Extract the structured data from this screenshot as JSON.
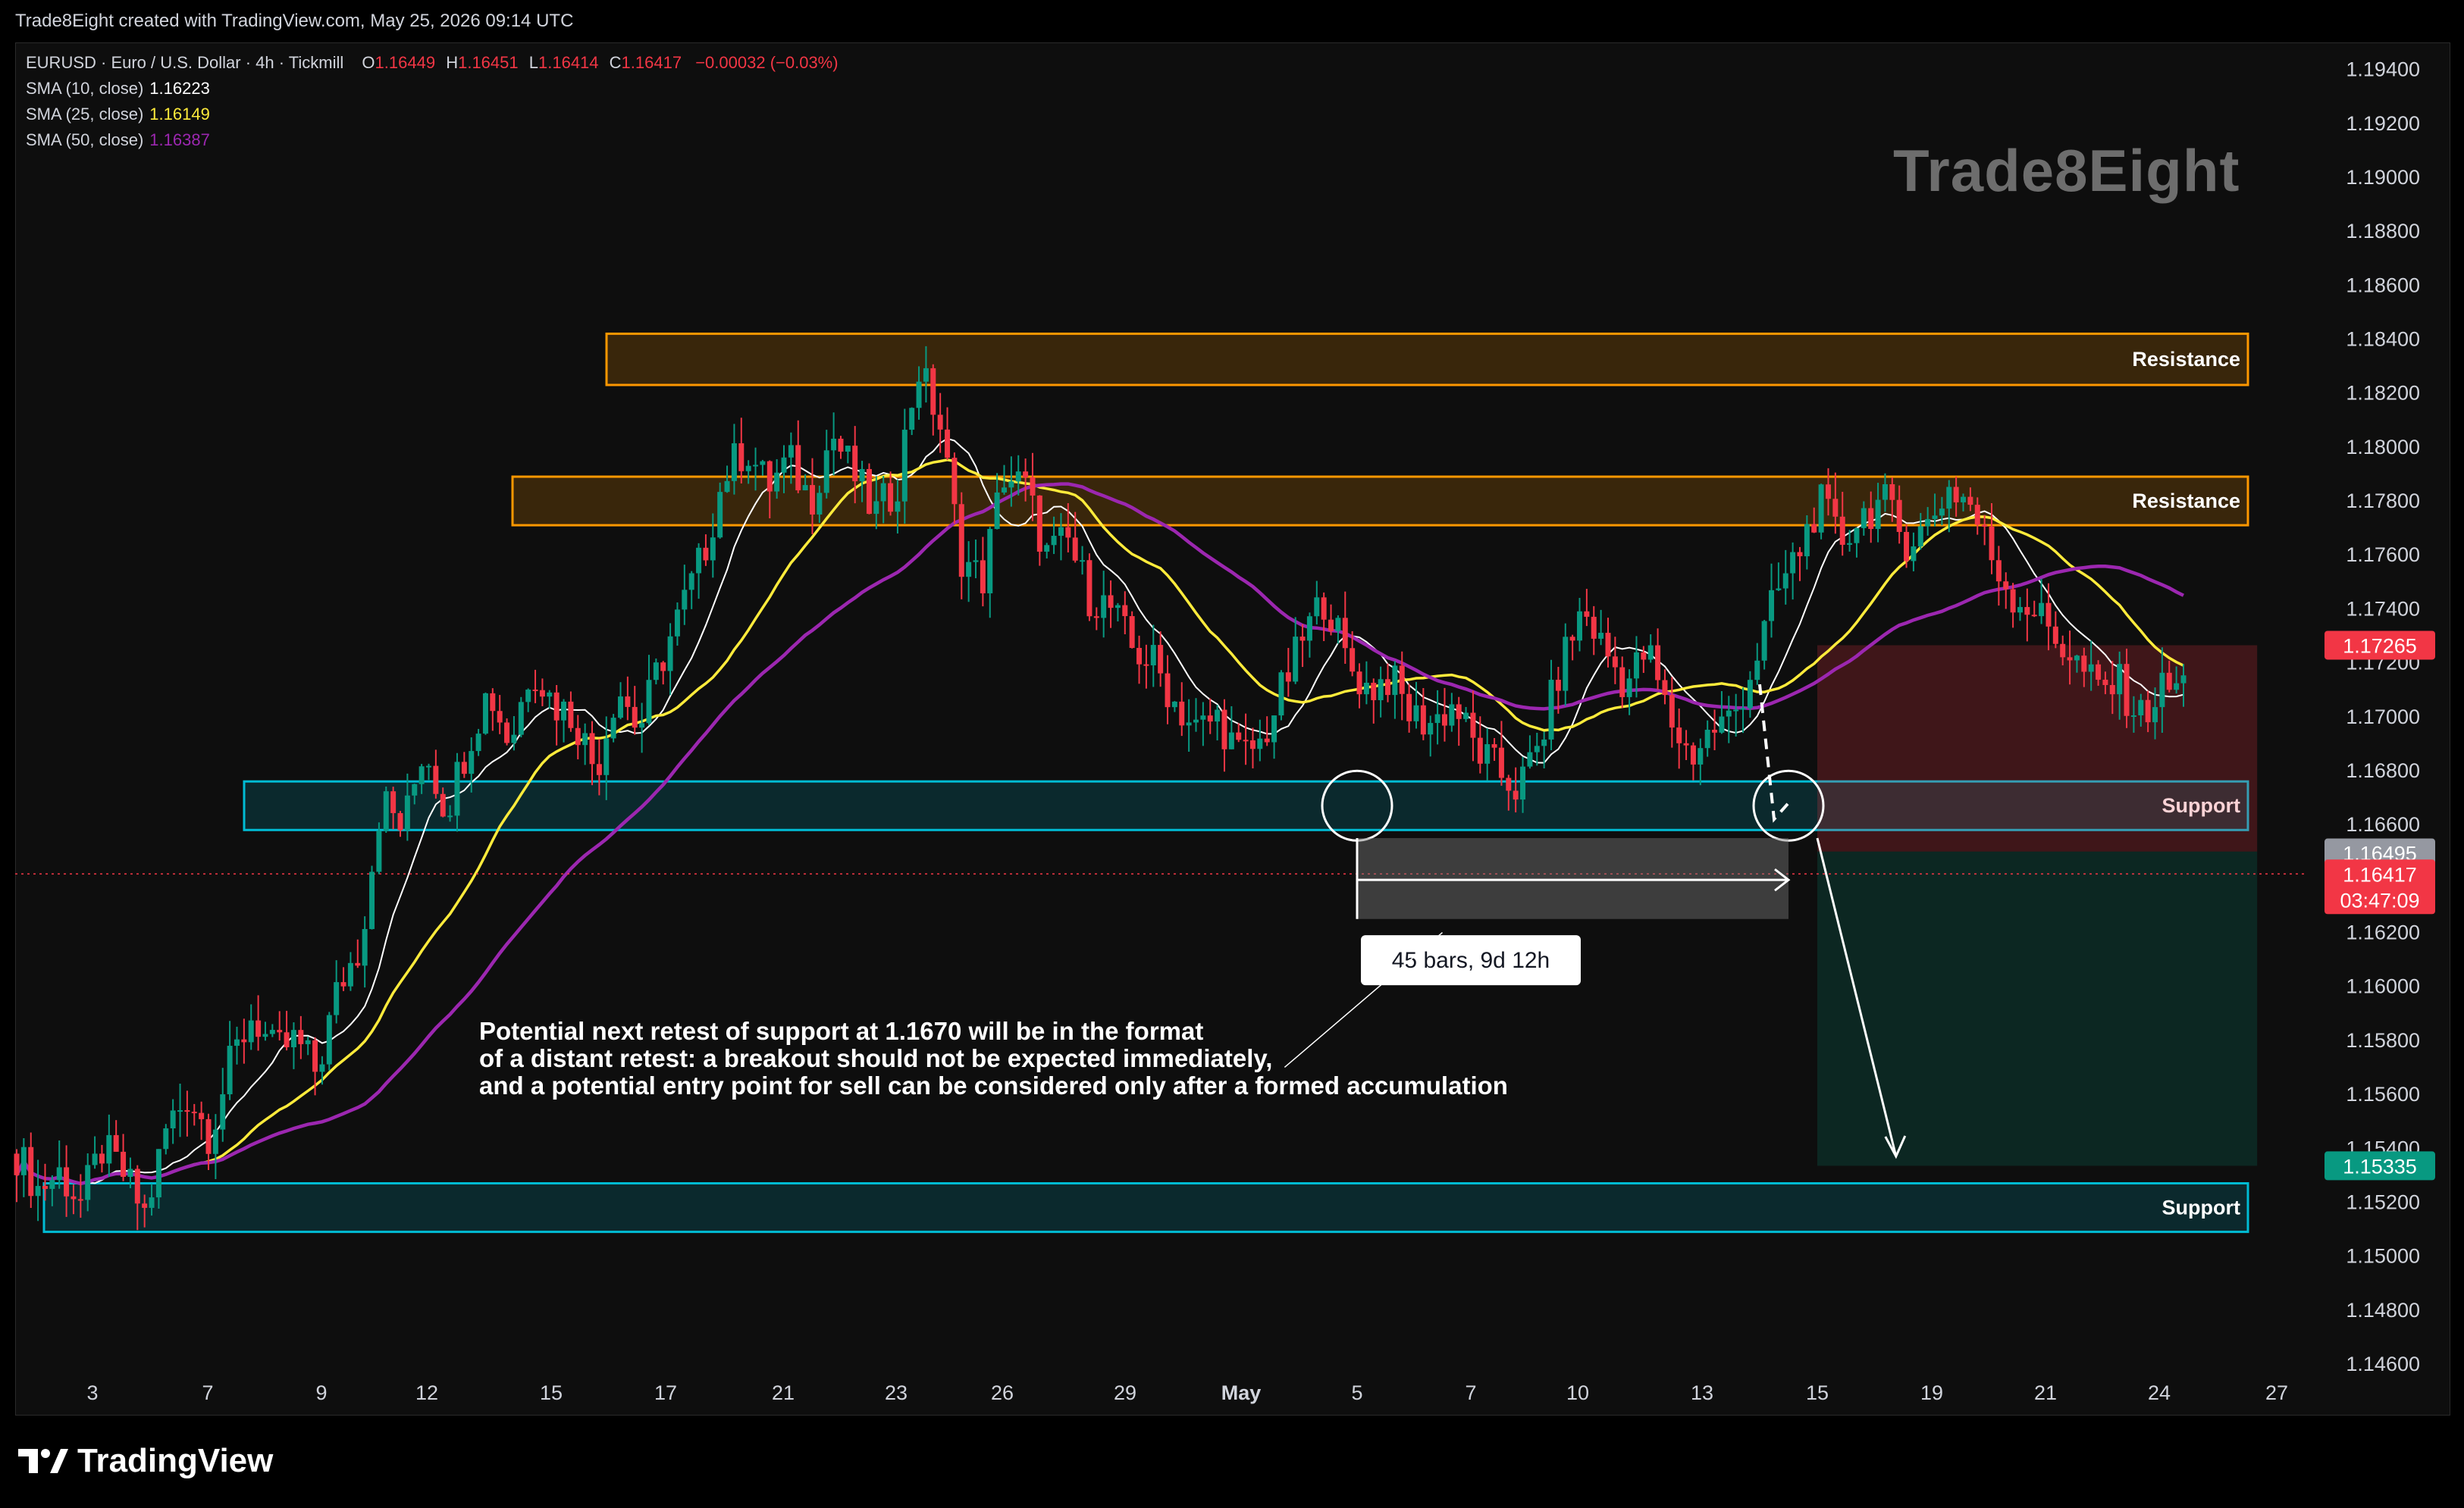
{
  "caption": "Trade8Eight created with TradingView.com, May 25, 2026 09:14 UTC",
  "legend": {
    "symbol": "EURUSD · Euro / U.S. Dollar · 4h · Tickmill",
    "o_label": "O",
    "o": "1.16449",
    "h_label": "H",
    "h": "1.16451",
    "l_label": "L",
    "l": "1.16414",
    "c_label": "C",
    "c": "1.16417",
    "change": "−0.00032 (−0.03%)",
    "sma10_label": "SMA (10, close)",
    "sma10": "1.16223",
    "sma25_label": "SMA (25, close)",
    "sma25": "1.16149",
    "sma50_label": "SMA (50, close)",
    "sma50": "1.16387"
  },
  "watermark": "Trade8Eight",
  "brand": "TradingView",
  "colors": {
    "bull": "#089981",
    "bear": "#f23645",
    "sma10": "#ffffff",
    "sma25": "#ffeb3b",
    "sma50": "#9c27b0",
    "resistance": "#ff9800",
    "support": "#00bcd4"
  },
  "chart_data": {
    "type": "candlestick",
    "symbol": "EURUSD",
    "timeframe": "4h",
    "ylim": [
      1.146,
      1.195
    ],
    "y_ticks": [
      "1.19400",
      "1.19200",
      "1.19000",
      "1.18800",
      "1.18600",
      "1.18400",
      "1.18200",
      "1.18000",
      "1.17800",
      "1.17600",
      "1.17400",
      "1.17200",
      "1.17000",
      "1.16800",
      "1.16600",
      "1.16200",
      "1.16000",
      "1.15800",
      "1.15600",
      "1.15400",
      "1.15200",
      "1.15000",
      "1.14800",
      "1.14600"
    ],
    "x_ticks": [
      {
        "label": "3",
        "date": "2026-04-03"
      },
      {
        "label": "7",
        "date": "2026-04-07"
      },
      {
        "label": "9",
        "date": "2026-04-09"
      },
      {
        "label": "12",
        "date": "2026-04-12"
      },
      {
        "label": "15",
        "date": "2026-04-15"
      },
      {
        "label": "17",
        "date": "2026-04-17"
      },
      {
        "label": "21",
        "date": "2026-04-21"
      },
      {
        "label": "23",
        "date": "2026-04-23"
      },
      {
        "label": "26",
        "date": "2026-04-26"
      },
      {
        "label": "29",
        "date": "2026-04-29"
      },
      {
        "label": "May",
        "date": "2026-05-01"
      },
      {
        "label": "5",
        "date": "2026-05-05"
      },
      {
        "label": "7",
        "date": "2026-05-07"
      },
      {
        "label": "10",
        "date": "2026-05-10"
      },
      {
        "label": "13",
        "date": "2026-05-13"
      },
      {
        "label": "15",
        "date": "2026-05-15"
      },
      {
        "label": "19",
        "date": "2026-05-19"
      },
      {
        "label": "21",
        "date": "2026-05-21"
      },
      {
        "label": "24",
        "date": "2026-05-24"
      },
      {
        "label": "27",
        "date": "2026-05-27"
      }
    ],
    "closes": [
      1.1538,
      1.1525,
      1.1531,
      1.152,
      1.154,
      1.153,
      1.1515,
      1.1548,
      1.156,
      1.1545,
      1.1572,
      1.159,
      1.1575,
      1.158,
      1.1568,
      1.16,
      1.1615,
      1.167,
      1.1658,
      1.169,
      1.1665,
      1.169,
      1.171,
      1.169,
      1.172,
      1.1705,
      1.17,
      1.168,
      1.1712,
      1.1695,
      1.172,
      1.174,
      1.176,
      1.179,
      1.18,
      1.1785,
      1.1795,
      1.178,
      1.1805,
      1.179,
      1.1775,
      1.1785,
      1.183,
      1.181,
      1.176,
      1.175,
      1.179,
      1.1785,
      1.176,
      1.1765,
      1.1745,
      1.174,
      1.1725,
      1.172,
      1.1705,
      1.1695,
      1.17,
      1.1685,
      1.169,
      1.171,
      1.173,
      1.1745,
      1.172,
      1.171,
      1.1715,
      1.17,
      1.1698,
      1.1705,
      1.1688,
      1.168,
      1.1673,
      1.169,
      1.172,
      1.174,
      1.1725,
      1.1712,
      1.1725,
      1.17,
      1.1685,
      1.1695,
      1.17,
      1.172,
      1.1745,
      1.176,
      1.178,
      1.1765,
      1.1775,
      1.178,
      1.1765,
      1.177,
      1.1785,
      1.178,
      1.176,
      1.1745,
      1.174,
      1.173,
      1.172,
      1.171,
      1.1712,
      1.17,
      1.171,
      1.1712
    ],
    "sma10": [
      1.155,
      1.1535,
      1.153,
      1.1528,
      1.153,
      1.1533,
      1.1535,
      1.154,
      1.1548,
      1.1556
    ],
    "sma25": [
      1.1555,
      1.155,
      1.1545,
      1.1543,
      1.1545,
      1.1548,
      1.1555,
      1.1565,
      1.158,
      1.16
    ],
    "sma50": [
      1.156,
      1.156,
      1.1558,
      1.1555,
      1.1556,
      1.156,
      1.157,
      1.1585,
      1.16,
      1.162
    ],
    "zones": [
      {
        "name": "Resistance",
        "from": 1.1823,
        "to": 1.1842
      },
      {
        "name": "Resistance",
        "from": 1.1771,
        "to": 1.1789
      },
      {
        "name": "Support",
        "from": 1.1658,
        "to": 1.1676
      },
      {
        "name": "Support",
        "from": 1.1509,
        "to": 1.1527
      }
    ],
    "price_labels": [
      {
        "value": "1.17265",
        "color": "#f23645"
      },
      {
        "value": "1.16495",
        "color": "#9598a1"
      },
      {
        "value": "1.16417",
        "color": "#f23645",
        "countdown": "03:47:09"
      },
      {
        "value": "1.15335",
        "color": "#089981"
      }
    ],
    "short_position": {
      "entry": 1.165,
      "stop": 1.17265,
      "target": 1.15335
    },
    "measure_label": "45 bars, 9d 12h",
    "annotation": [
      "Potential next retest of support at 1.1670 will be in the format",
      "of a distant retest: a breakout should not be expected immediately,",
      "and a potential entry point for sell can be considered only after a formed accumulation"
    ]
  }
}
